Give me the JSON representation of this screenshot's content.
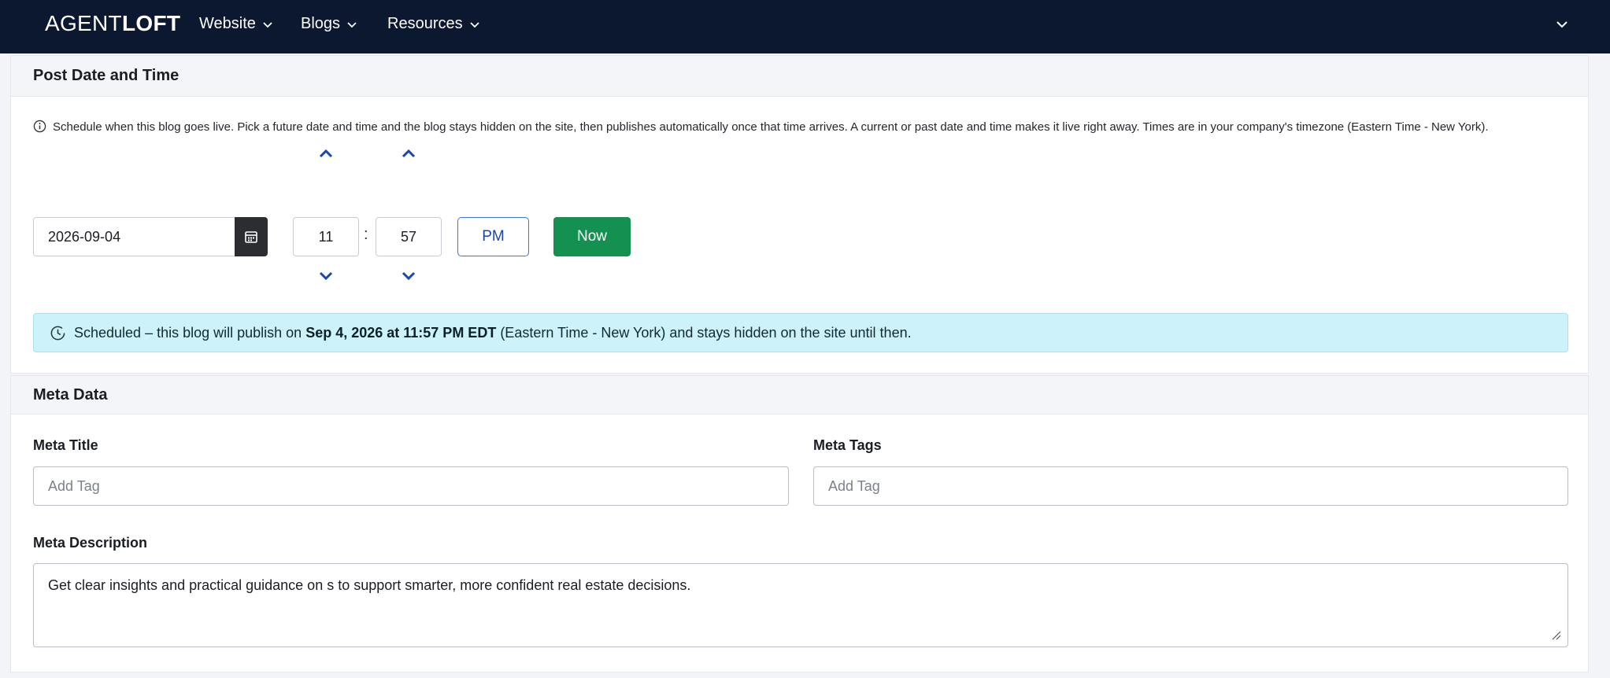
{
  "nav": {
    "brand_light": "AGENT",
    "brand_bold": "LOFT",
    "items": [
      {
        "label": "Website"
      },
      {
        "label": "Blogs"
      },
      {
        "label": "Resources"
      }
    ]
  },
  "schedule": {
    "section_title": "Post Date and Time",
    "info_text": "Schedule when this blog goes live. Pick a future date and time and the blog stays hidden on the site, then publishes automatically once that time arrives. A current or past date and time makes it live right away. Times are in your company's timezone (Eastern Time - New York).",
    "date_value": "2026-09-04",
    "hour_value": "11",
    "minute_value": "57",
    "colon": ":",
    "ampm_label": "PM",
    "now_label": "Now",
    "alert_prefix": "Scheduled – this blog will publish on ",
    "alert_datetime": "Sep 4, 2026 at 11:57 PM EDT",
    "alert_suffix": " (Eastern Time - New York) and stays hidden on the site until then."
  },
  "meta": {
    "section_title": "Meta Data",
    "title_label": "Meta Title",
    "title_placeholder": "Add Tag",
    "tags_label": "Meta Tags",
    "tags_placeholder": "Add Tag",
    "description_label": "Meta Description",
    "description_value": "Get clear insights and practical guidance on s to support smarter, more confident real estate decisions."
  },
  "colors": {
    "nav_bg": "#0c1730",
    "now_button": "#149151",
    "alert_bg": "#cdf2fa",
    "spinner_arrow": "#1846b6"
  },
  "icons": [
    "chevron-down-icon",
    "calendar-icon",
    "info-icon",
    "clock-icon",
    "chevron-up-icon",
    "resize-grip-icon"
  ]
}
